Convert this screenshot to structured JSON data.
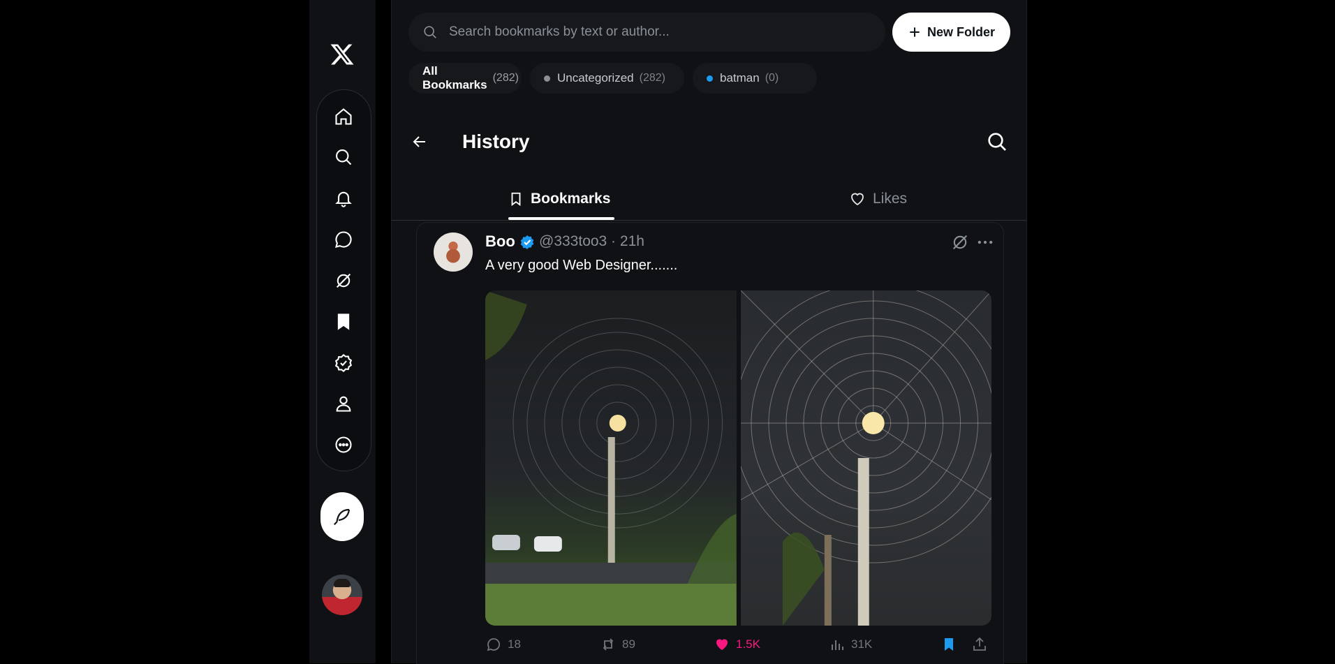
{
  "nav": {
    "logo": "x-logo",
    "items": [
      "home-icon",
      "search-icon",
      "notifications-icon",
      "messages-icon",
      "grok-icon",
      "bookmarks-icon",
      "verified-icon",
      "profile-icon",
      "more-icon"
    ]
  },
  "bookmarks_panel": {
    "search_placeholder": "Search bookmarks by text or author...",
    "new_folder_label": "New Folder",
    "folders": [
      {
        "name": "All Bookmarks",
        "count": "(282)"
      },
      {
        "name": "Uncategorized",
        "count": "(282)",
        "dot_color": "#8b9198"
      },
      {
        "name": "batman",
        "count": "(0)",
        "dot_color": "#1d9bf0"
      }
    ]
  },
  "header": {
    "title": "History",
    "tabs": [
      {
        "label": "Bookmarks"
      },
      {
        "label": "Likes"
      }
    ]
  },
  "tweet": {
    "name": "Boo",
    "handle_time": "@333too3 · 21h",
    "text": "A very good Web Designer.......",
    "stats": {
      "replies": "18",
      "reposts": "89",
      "likes": "1.5K",
      "views": "31K"
    }
  },
  "colors": {
    "accent": "#1d9bf0",
    "like": "#f91880",
    "background": "#0f1115"
  }
}
